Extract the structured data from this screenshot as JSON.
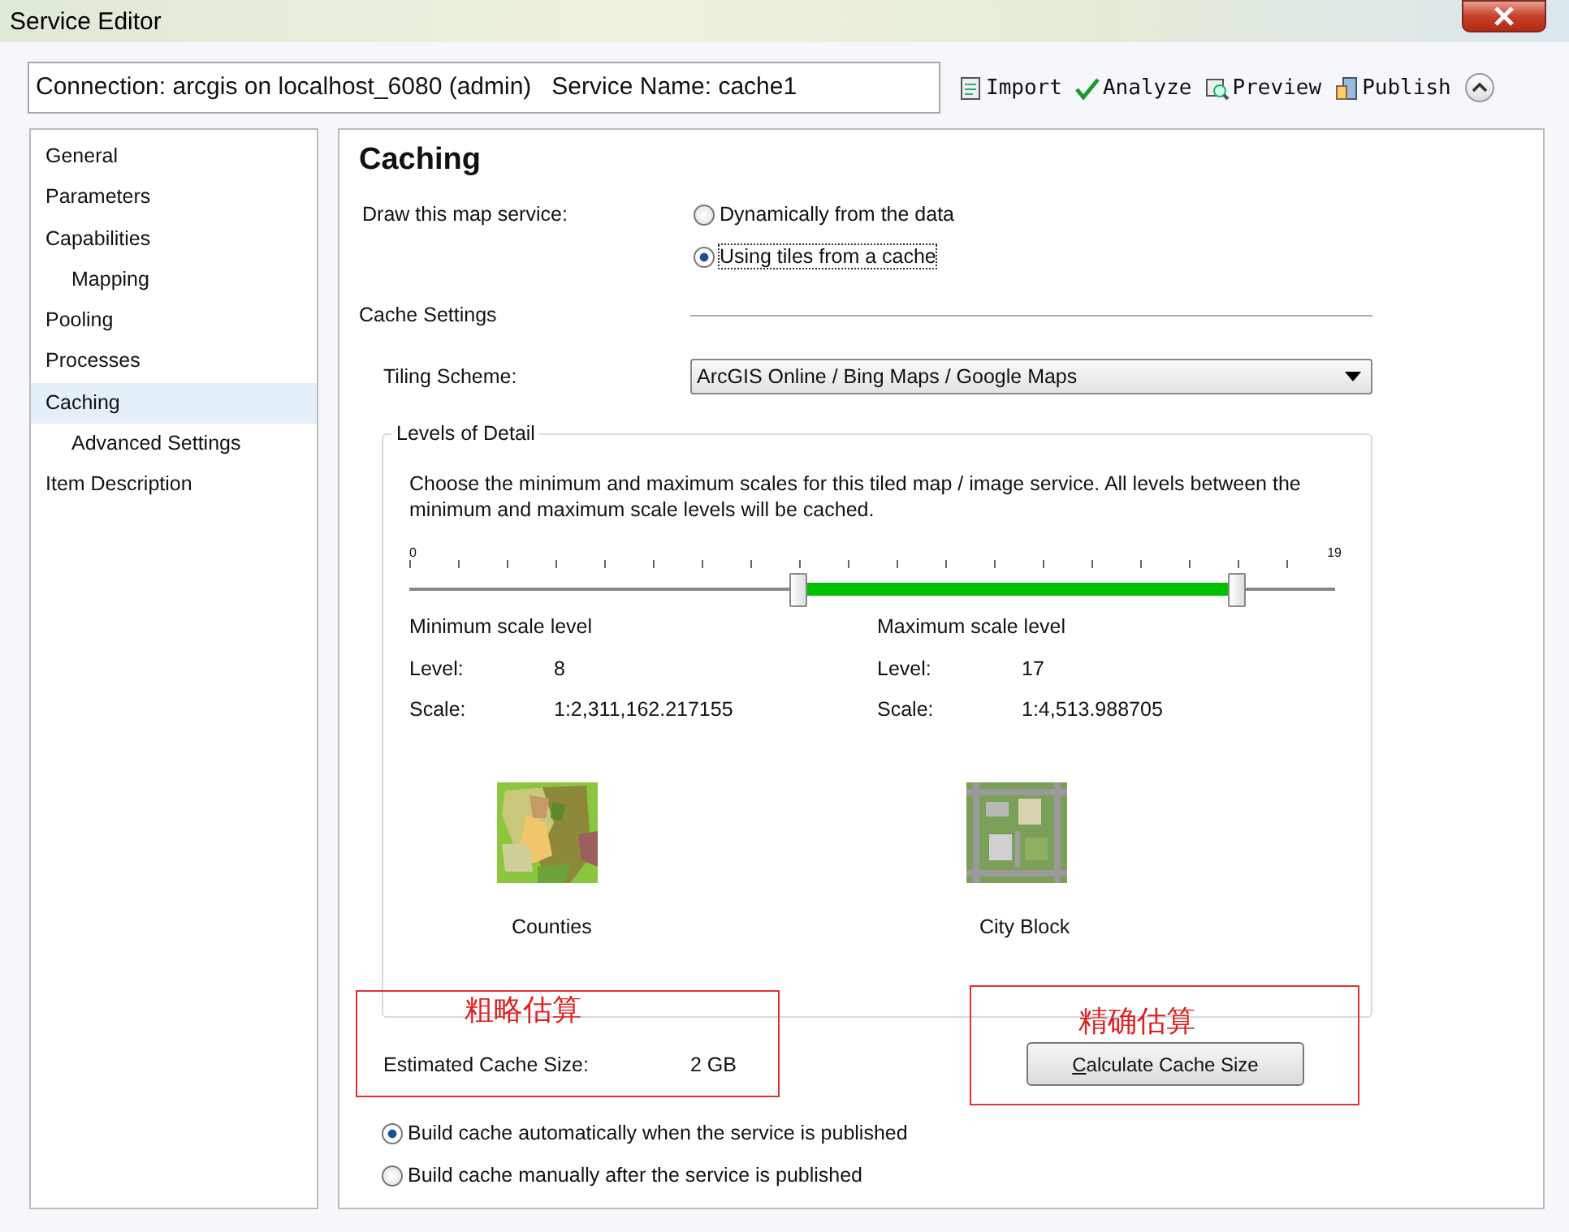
{
  "window": {
    "title": "Service Editor"
  },
  "header": {
    "connection": "Connection: arcgis on localhost_6080 (admin)   Service Name: cache1",
    "tools": [
      {
        "kind": "import",
        "label": "Import"
      },
      {
        "kind": "analyze",
        "label": "Analyze"
      },
      {
        "kind": "preview",
        "label": "Preview"
      },
      {
        "kind": "publish",
        "label": "Publish"
      }
    ]
  },
  "sidebar": {
    "items": [
      {
        "label": "General",
        "selected": false
      },
      {
        "label": "Parameters",
        "selected": false
      },
      {
        "label": "Capabilities",
        "selected": false,
        "children": [
          {
            "label": "Mapping",
            "selected": false
          }
        ]
      },
      {
        "label": "Pooling",
        "selected": false
      },
      {
        "label": "Processes",
        "selected": false
      },
      {
        "label": "Caching",
        "selected": true,
        "children": [
          {
            "label": "Advanced Settings",
            "selected": false
          }
        ]
      },
      {
        "label": "Item Description",
        "selected": false
      }
    ]
  },
  "panel": {
    "title": "Caching",
    "draw_label": "Draw this map service:",
    "draw_options": [
      {
        "label": "Dynamically from the data",
        "selected": false
      },
      {
        "label": "Using tiles from a cache",
        "selected": true
      }
    ],
    "cache_settings": "Cache Settings",
    "tiling_label": "Tiling Scheme:",
    "tiling_value": "ArcGIS Online / Bing Maps / Google Maps",
    "lod": {
      "title": "Levels of Detail",
      "description": "Choose the minimum and maximum scales for this tiled map / image service. All levels between the minimum and maximum scale levels will be cached.",
      "slider": {
        "min_label": "0",
        "max_label": "19",
        "thumbs": [
          {
            "level": 0.421
          },
          {
            "level": 0.895
          }
        ]
      },
      "ranges": [
        {
          "heading": "Minimum scale level",
          "level_label": "Level:",
          "level_value": "8",
          "scale_label": "Scale:",
          "scale_value": "1:2,311,162.217155"
        },
        {
          "heading": "Maximum scale level",
          "level_label": "Level:",
          "level_value": "17",
          "scale_label": "Scale:",
          "scale_value": "1:4,513.988705"
        }
      ],
      "examples": [
        {
          "kind": "counties",
          "name": "Counties"
        },
        {
          "kind": "city",
          "name": "City Block"
        }
      ]
    },
    "estimate": {
      "label": "Estimated Cache Size:",
      "value": "2 GB"
    },
    "calculate_button": "Calculate Cache Size",
    "build_options": [
      {
        "label": "Build cache automatically when the service is published",
        "selected": true
      },
      {
        "label": "Build cache manually after the service is published",
        "selected": false
      }
    ],
    "annotations": [
      {
        "text": "粗略估算"
      },
      {
        "text": "精确估算"
      }
    ]
  }
}
